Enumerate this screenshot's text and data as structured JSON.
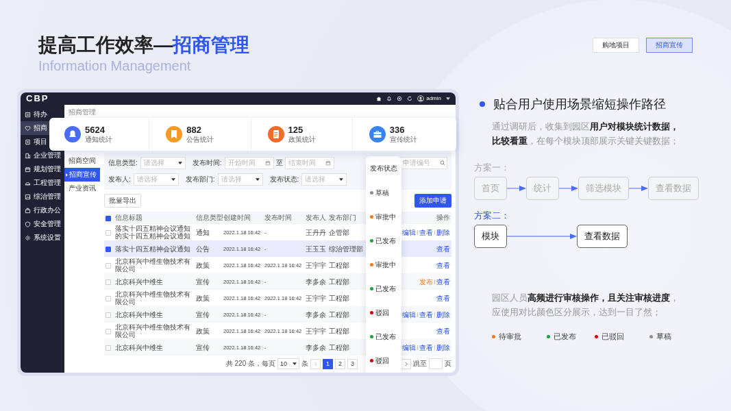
{
  "slide": {
    "title_prefix": "提高工作效率—",
    "title_highlight": "招商管理",
    "subtitle": "Information Management",
    "tabs": [
      {
        "label": "购地项目",
        "selected": false
      },
      {
        "label": "招商宣传",
        "selected": true
      }
    ]
  },
  "app": {
    "logo": "CBP",
    "user": "admin",
    "sidebar": [
      {
        "label": "待办",
        "selected": false
      },
      {
        "label": "招商",
        "selected": true
      },
      {
        "label": "项目",
        "selected": false
      },
      {
        "label": "企业管理",
        "selected": false
      },
      {
        "label": "规划管理",
        "selected": false
      },
      {
        "label": "工程管理",
        "selected": false
      },
      {
        "label": "综治管理",
        "selected": false
      },
      {
        "label": "行政办公",
        "selected": false
      },
      {
        "label": "安全管理",
        "selected": false
      },
      {
        "label": "系统设置",
        "selected": false
      }
    ],
    "submenu": {
      "header": "招商管理",
      "items": [
        {
          "label": "招商空间",
          "selected": false
        },
        {
          "label": "招商宣传",
          "selected": true
        },
        {
          "label": "产业资讯",
          "selected": false
        }
      ]
    },
    "stats": [
      {
        "value": "5624",
        "label": "通知统计",
        "color": "#4a6cf0"
      },
      {
        "value": "882",
        "label": "公告统计",
        "color": "#f59a23"
      },
      {
        "value": "125",
        "label": "政策统计",
        "color": "#f26b2a"
      },
      {
        "value": "336",
        "label": "宣传统计",
        "color": "#3b82f0"
      }
    ],
    "filter_rows": [
      [
        {
          "kind": "select",
          "label": "信息类型:",
          "placeholder": "请选择"
        },
        {
          "kind": "daterange",
          "label": "发布时间:",
          "placeholder": "开始时间",
          "separator": "至",
          "placeholder_end": "结束时间"
        }
      ],
      [
        {
          "kind": "select",
          "label": "发布人:",
          "placeholder": "请选择"
        },
        {
          "kind": "select",
          "label": "发布部门:",
          "placeholder": "请选择"
        },
        {
          "kind": "select",
          "label": "发布状态:",
          "placeholder": "请选择"
        }
      ]
    ],
    "search": {
      "placeholder": "申请编号"
    },
    "toolbar": {
      "export": "批量导出",
      "add": "添加申请"
    },
    "table": {
      "select_all_partial": true,
      "columns": [
        "信息标题",
        "信息类型",
        "创建时间",
        "发布时间",
        "发布人",
        "发布部门",
        "操作"
      ],
      "rows": [
        {
          "checked": false,
          "title": "落实十四五精神会议通知的实十四五精神会议通知",
          "type": "通知",
          "created": "2022.1.18 16:42",
          "published": "-",
          "publisher": "王丹丹",
          "dept": "企管部",
          "actions": [
            {
              "label": "编辑",
              "kind": "link"
            },
            {
              "label": "查看",
              "kind": "link"
            },
            {
              "label": "删除",
              "kind": "link"
            }
          ]
        },
        {
          "checked": true,
          "title": "落实十四五精神会议通知",
          "type": "公告",
          "created": "2022.1.18 16:42",
          "published": "-",
          "publisher": "王玉玉",
          "dept": "综治管理部",
          "actions": [
            {
              "label": "查看",
              "kind": "link"
            }
          ]
        },
        {
          "checked": false,
          "title": "北京科兴中维生物技术有限公司",
          "type": "政策",
          "created": "2022.1.18 16:42",
          "published": "2022.1.18 16:42",
          "publisher": "王宇宇",
          "dept": "工程部",
          "actions": [
            {
              "label": "查看",
              "kind": "link"
            }
          ]
        },
        {
          "checked": false,
          "title": "北京科兴中维生",
          "type": "宣传",
          "created": "2022.1.18 16:42",
          "published": "-",
          "publisher": "李多余",
          "dept": "工程部",
          "actions": [
            {
              "label": "发布",
              "kind": "warning"
            },
            {
              "label": "查看",
              "kind": "link"
            }
          ]
        },
        {
          "checked": false,
          "title": "北京科兴中维生物技术有限公司",
          "type": "政策",
          "created": "2022.1.18 16:42",
          "published": "2022.1.18 16:42",
          "publisher": "王宇宇",
          "dept": "工程部",
          "actions": [
            {
              "label": "查看",
              "kind": "link"
            }
          ]
        },
        {
          "checked": false,
          "title": "北京科兴中维生",
          "type": "宣传",
          "created": "2022.1.18 16:42",
          "published": "-",
          "publisher": "李多余",
          "dept": "工程部",
          "actions": [
            {
              "label": "编辑",
              "kind": "link"
            },
            {
              "label": "查看",
              "kind": "link"
            },
            {
              "label": "删除",
              "kind": "link"
            }
          ]
        },
        {
          "checked": false,
          "title": "北京科兴中维生物技术有限公司",
          "type": "政策",
          "created": "2022.1.18 16:42",
          "published": "2022.1.18 16:42",
          "publisher": "王宇宇",
          "dept": "工程部",
          "actions": [
            {
              "label": "查看",
              "kind": "link"
            }
          ]
        },
        {
          "checked": false,
          "title": "北京科兴中维生",
          "type": "宣传",
          "created": "2022.1.18 16:42",
          "published": "-",
          "publisher": "李多余",
          "dept": "工程部",
          "actions": [
            {
              "label": "编辑",
              "kind": "link"
            },
            {
              "label": "查看",
              "kind": "link"
            },
            {
              "label": "删除",
              "kind": "link"
            }
          ]
        }
      ]
    },
    "status_popup": {
      "title": "发布状态",
      "items": [
        {
          "label": "草稿",
          "color": "#8c8c8c"
        },
        {
          "label": "审批中",
          "color": "#f07a17"
        },
        {
          "label": "已发布",
          "color": "#1aa33a"
        },
        {
          "label": "审批中",
          "color": "#f07a17"
        },
        {
          "label": "已发布",
          "color": "#1aa33a"
        },
        {
          "label": "驳回",
          "color": "#d60000"
        },
        {
          "label": "已发布",
          "color": "#1aa33a"
        },
        {
          "label": "驳回",
          "color": "#d60000"
        }
      ]
    },
    "pagination": {
      "total": "共 220 条，每页",
      "page_size": "10",
      "unit": "条",
      "pages": [
        {
          "label": "1",
          "selected": true
        },
        {
          "label": "2",
          "selected": false
        },
        {
          "label": "3",
          "selected": false
        }
      ],
      "jump": "跳至",
      "page_unit": "页"
    }
  },
  "right": {
    "heading": "贴合用户使用场景缩短操作路径",
    "paragraph": "通过调研后，收集到园区**用户对模块统计数据，比较看重**，在每个模块顶部展示关键关键数据；",
    "plans": [
      {
        "label": "方案一：",
        "highlighted": false,
        "steps": [
          "首页",
          "统计",
          "筛选模块",
          "查看数据"
        ]
      },
      {
        "label": "方案二：",
        "highlighted": true,
        "steps": [
          "模块",
          "查看数据"
        ]
      }
    ],
    "paragraph2": "园区人员**高频进行审核操作，且关注审核进度**，应使用对比颜色区分展示，达到一目了然；",
    "legend": [
      {
        "label": "待审批",
        "color": "#f07a17"
      },
      {
        "label": "已发布",
        "color": "#1aa33a"
      },
      {
        "label": "已驳回",
        "color": "#d60000"
      },
      {
        "label": "草稿",
        "color": "#8c8c8c"
      }
    ]
  }
}
